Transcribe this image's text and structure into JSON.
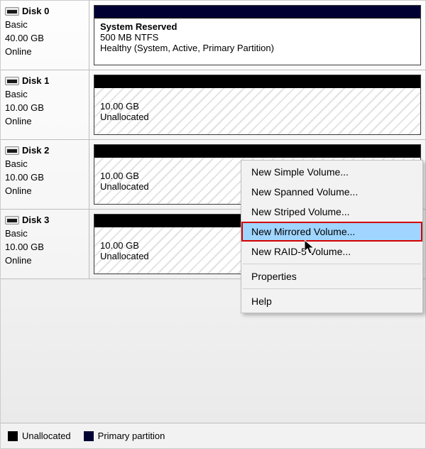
{
  "disks": [
    {
      "name": "Disk 0",
      "type": "Basic",
      "size": "40.00 GB",
      "status": "Online"
    },
    {
      "name": "Disk 1",
      "type": "Basic",
      "size": "10.00 GB",
      "status": "Online"
    },
    {
      "name": "Disk 2",
      "type": "Basic",
      "size": "10.00 GB",
      "status": "Online"
    },
    {
      "name": "Disk 3",
      "type": "Basic",
      "size": "10.00 GB",
      "status": "Online"
    }
  ],
  "volumes": {
    "system_reserved": {
      "title": "System Reserved",
      "details": "500 MB NTFS",
      "status": "Healthy (System, Active, Primary Partition)"
    },
    "unalloc": [
      {
        "size": "10.00 GB",
        "label": "Unallocated"
      },
      {
        "size": "10.00 GB",
        "label": "Unallocated"
      },
      {
        "size": "10.00 GB",
        "label": "Unallocated"
      }
    ]
  },
  "context_menu": {
    "items": [
      "New Simple Volume...",
      "New Spanned Volume...",
      "New Striped Volume...",
      "New Mirrored Volume...",
      "New RAID-5 Volume...",
      "Properties",
      "Help"
    ]
  },
  "legend": {
    "unallocated": "Unallocated",
    "primary": "Primary partition"
  },
  "colors": {
    "primary_partition": "#000032",
    "unallocated": "#000000",
    "highlight": "#9fd5ff",
    "highlight_border": "#d40000"
  }
}
